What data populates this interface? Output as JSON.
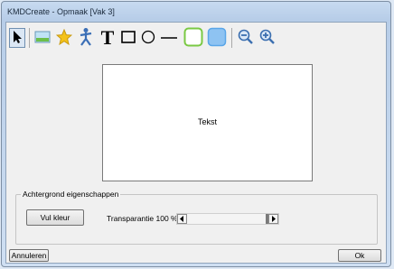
{
  "window": {
    "title": "KMDCreate - Opmaak [Vak 3]"
  },
  "toolbar": {
    "tools": [
      {
        "name": "select-arrow",
        "icon": "arrow-pointer-icon",
        "selected": true
      },
      {
        "name": "image",
        "icon": "image-icon"
      },
      {
        "name": "star",
        "icon": "star-icon"
      },
      {
        "name": "figure",
        "icon": "person-figure-icon"
      },
      {
        "name": "text",
        "icon": "text-t-icon",
        "glyph": "T"
      },
      {
        "name": "rectangle",
        "icon": "rectangle-icon"
      },
      {
        "name": "ellipse",
        "icon": "ellipse-icon"
      },
      {
        "name": "line",
        "icon": "line-icon"
      },
      {
        "name": "rounded-rect-green",
        "icon": "rounded-rect-green-icon"
      },
      {
        "name": "rounded-rect-blue",
        "icon": "rounded-rect-blue-icon"
      },
      {
        "name": "zoom-out",
        "icon": "zoom-out-icon"
      },
      {
        "name": "zoom-in",
        "icon": "zoom-in-icon"
      }
    ],
    "colors": {
      "star": "#f4c21a",
      "green": "#7ac943",
      "blue": "#5aa6e8",
      "zoom": "#3c6fb0"
    }
  },
  "canvas": {
    "text": "Tekst"
  },
  "background_panel": {
    "title": "Achtergrond eigenschappen",
    "fill_button": "Vul kleur",
    "transparency_label": "Transparantie 100 %",
    "transparency_value": 100
  },
  "footer": {
    "cancel": "Annuleren",
    "ok": "Ok"
  }
}
